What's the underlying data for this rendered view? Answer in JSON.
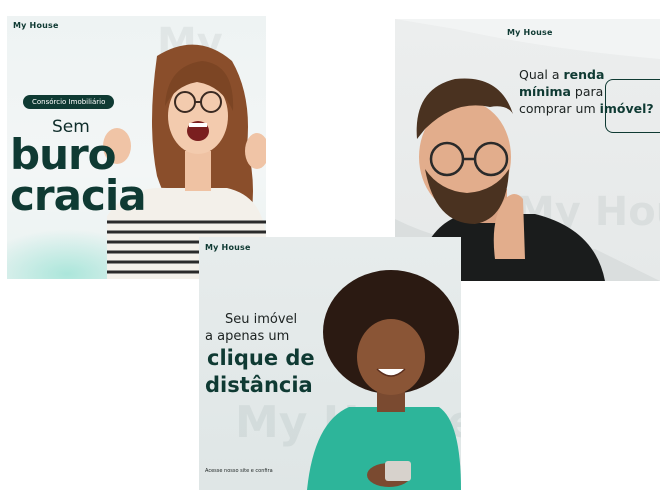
{
  "logo_text": "My House",
  "card1": {
    "badge": "Consórcio Imobiliário",
    "line1": "Sem",
    "line2": "buro",
    "line3": "cracia"
  },
  "card2": {
    "q1": "Qual a ",
    "q1b": "renda",
    "q2b": "mínima",
    "q2": " para",
    "q3": "comprar um ",
    "q3b": "imóvel?"
  },
  "card3": {
    "line1": "Seu imóvel",
    "line2": "a apenas um",
    "line3": "clique de",
    "line4": "distância",
    "footer": "Acesse nosso site e confira"
  },
  "colors": {
    "brand_dark": "#0f3a33",
    "text": "#1c2221"
  }
}
